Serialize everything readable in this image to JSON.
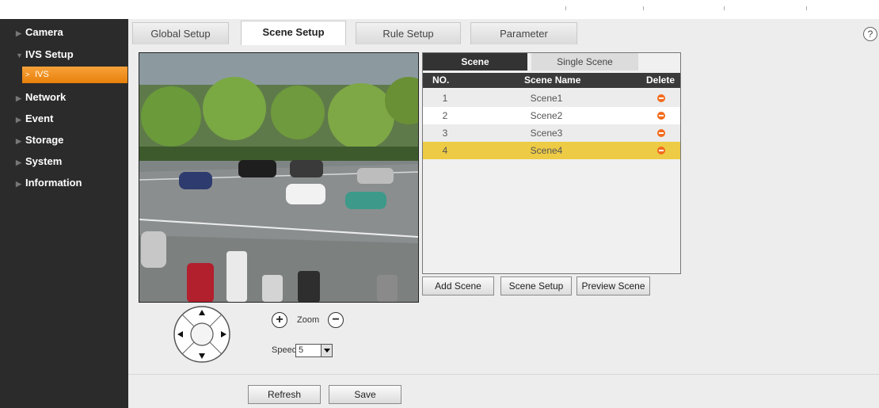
{
  "sidebar": {
    "items": [
      {
        "label": "Camera"
      },
      {
        "label": "IVS Setup"
      },
      {
        "label": "Network"
      },
      {
        "label": "Event"
      },
      {
        "label": "Storage"
      },
      {
        "label": "System"
      },
      {
        "label": "Information"
      }
    ],
    "sub_item": {
      "label": "IVS"
    }
  },
  "tabs": [
    {
      "label": "Global Setup"
    },
    {
      "label": "Scene Setup"
    },
    {
      "label": "Rule Setup"
    },
    {
      "label": "Parameter"
    }
  ],
  "active_tab": "Scene Setup",
  "help_icon": "question-circle-icon",
  "scene_panel": {
    "tabs": [
      {
        "label": "Scene"
      },
      {
        "label": "Single Scene"
      }
    ],
    "columns": [
      "NO.",
      "Scene Name",
      "Delete"
    ],
    "rows": [
      {
        "no": "1",
        "name": "Scene1"
      },
      {
        "no": "2",
        "name": "Scene2"
      },
      {
        "no": "3",
        "name": "Scene3"
      },
      {
        "no": "4",
        "name": "Scene4"
      }
    ],
    "selected_row": 4,
    "delete_icon": "minus-circle-icon"
  },
  "buttons": {
    "add_scene": "Add Scene",
    "scene_setup": "Scene Setup",
    "preview_scene": "Preview Scene",
    "refresh": "Refresh",
    "save": "Save"
  },
  "ptz": {
    "zoom_label": "Zoom",
    "zoom_in": "+",
    "zoom_out": "−",
    "speed_label": "Speed",
    "speed_value": "5"
  },
  "colors": {
    "accent": "#f08a1a",
    "selected_row": "#eecb44",
    "sidebar_bg": "#2b2b2b",
    "delete": "#f26c1d"
  }
}
